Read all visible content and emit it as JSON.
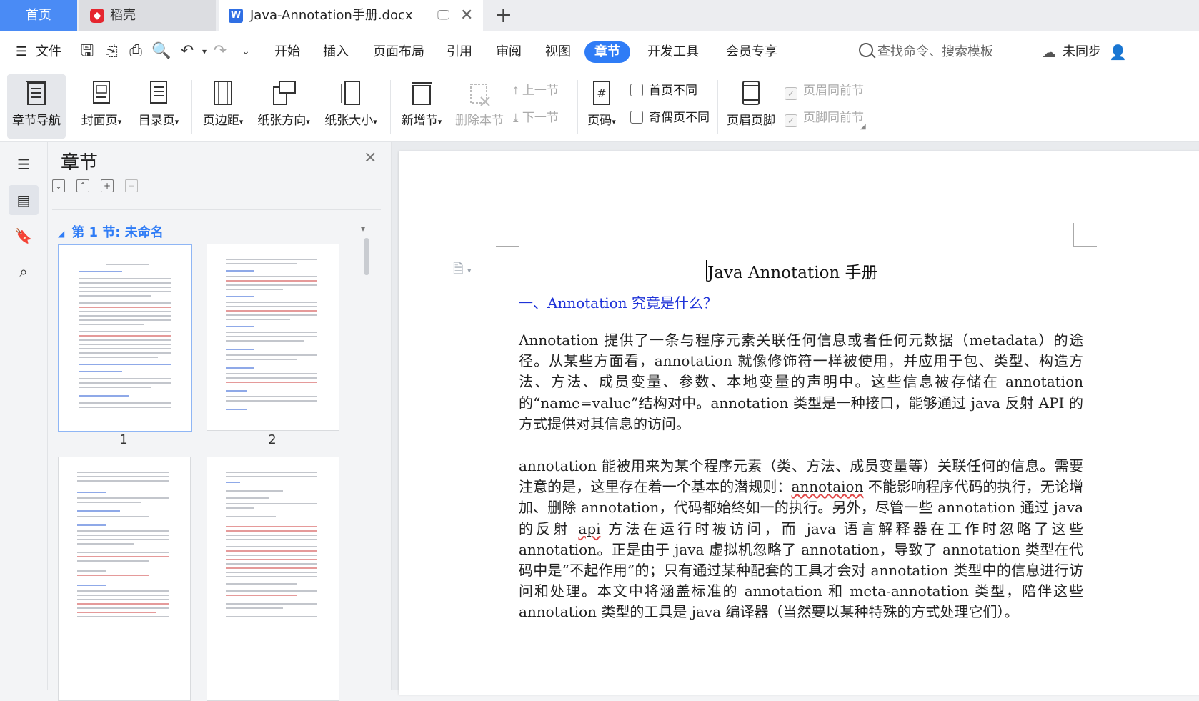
{
  "tabs": {
    "home": "首页",
    "docer": "稻壳",
    "document": "Java-Annotation手册.docx",
    "add": "+"
  },
  "menubar": {
    "file": "文件",
    "items": [
      "开始",
      "插入",
      "页面布局",
      "引用",
      "审阅",
      "视图",
      "章节",
      "开发工具",
      "会员专享"
    ],
    "active_item": "章节",
    "search_placeholder": "查找命令、搜索模板",
    "sync_status": "未同步"
  },
  "ribbon": {
    "section_nav": "章节导航",
    "cover_page": "封面页",
    "toc_page": "目录页",
    "margins": "页边距",
    "orientation": "纸张方向",
    "paper_size": "纸张大小",
    "new_section": "新增节",
    "delete_section": "删除本节",
    "prev_section": "上一节",
    "next_section": "下一节",
    "page_number": "页码",
    "first_page_diff": "首页不同",
    "odd_even_diff": "奇偶页不同",
    "header_footer": "页眉页脚",
    "header_same_prev": "页眉同前节",
    "footer_same_prev": "页脚同前节",
    "dropdown_arrow": "▾"
  },
  "nav_panel": {
    "title": "章节",
    "section_label": "第 1 节: 未命名",
    "page_numbers": [
      "1",
      "2"
    ]
  },
  "document": {
    "title": "Java Annotation 手册",
    "heading1": "一、Annotation 究竟是什么？",
    "para1": "Annotation 提供了一条与程序元素关联任何信息或者任何元数据（metadata）的途径。从某些方面看，annotation 就像修饰符一样被使用，并应用于包、类型、构造方法、方法、成员变量、参数、本地变量的声明中。这些信息被存储在 annotation 的“name=value”结构对中。annotation 类型是一种接口，能够通过 java 反射 API 的方式提供对其信息的访问。",
    "para2_a": "annotation 能被用来为某个程序元素（类、方法、成员变量等）关联任何的信息。需要注意的是，这里存在着一个基本的潜规则：",
    "para2_typo1": "annotaion",
    "para2_b": " 不能影响程序代码的执行，无论增加、删除 annotation，代码都始终如一的执行。另外，尽管一些 annotation 通过 java 的反射 ",
    "para2_typo2": "api",
    "para2_c": " 方法在运行时被访问，而 java 语言解释器在工作时忽略了这些 annotation。正是由于 java 虚拟机忽略了 annotation，导致了 annotation 类型在代码中是“不起作用”的；只有通过某种配套的工具才会对 annotation 类型中的信息进行访问和处理。本文中将涵盖标准的 annotation 和 meta-annotation 类型，陪伴这些 annotation 类型的工具是 java 编译器（当然要以某种特殊的方式处理它们）。"
  },
  "colors": {
    "accent": "#2f7cf6",
    "home_tab": "#4a8bf5",
    "heading_blue": "#1f33d8"
  }
}
